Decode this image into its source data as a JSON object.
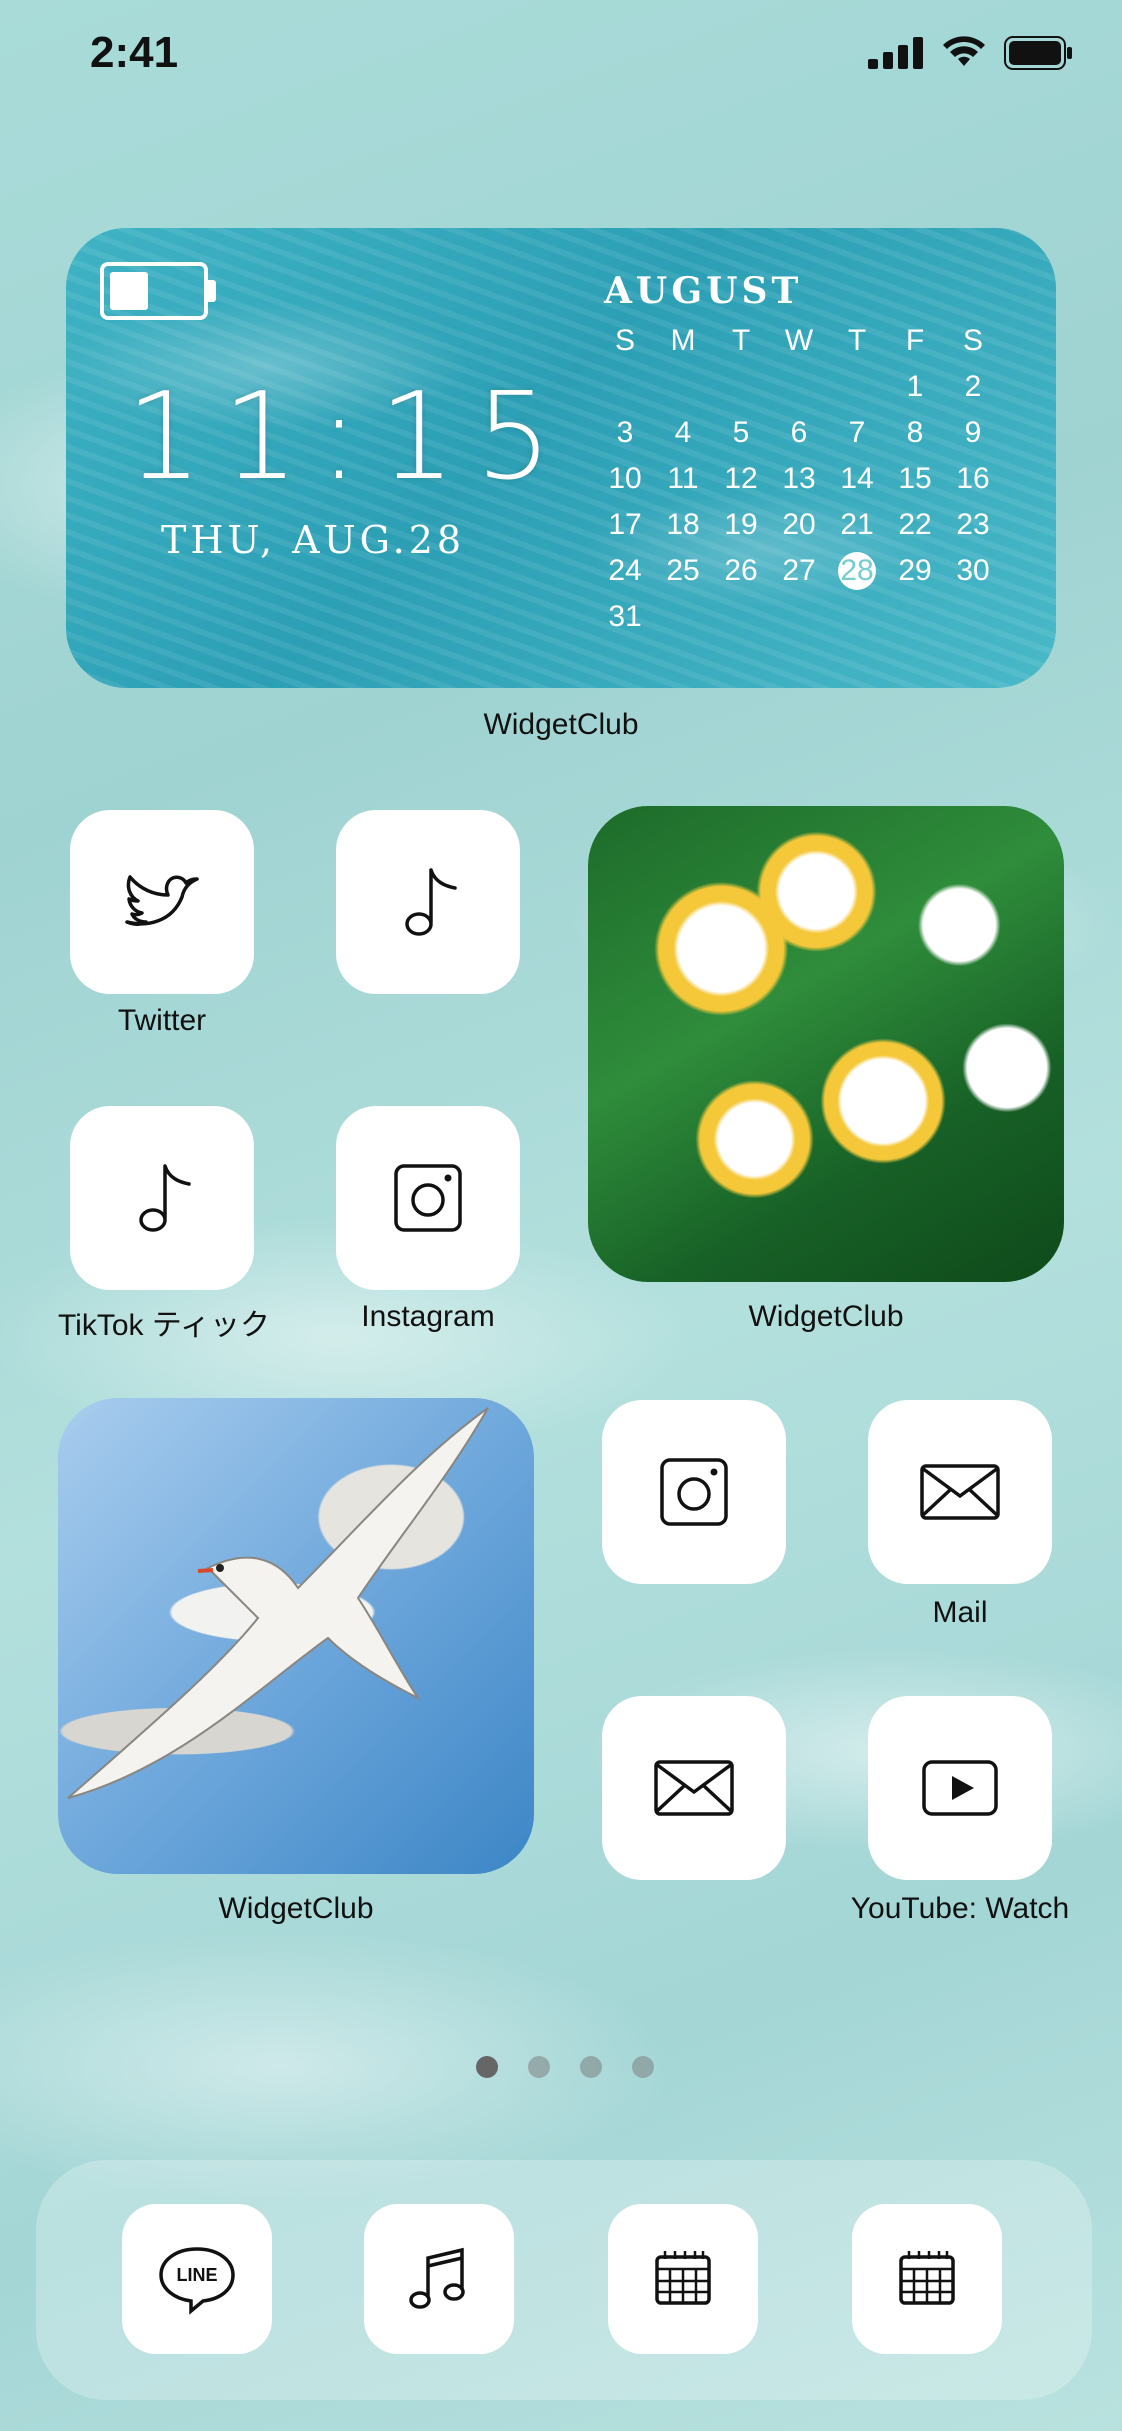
{
  "status": {
    "time": "2:41"
  },
  "widget_top": {
    "clock": "11:15",
    "date": "THU, AUG.28",
    "month": "AUGUST",
    "weekdays": [
      "S",
      "M",
      "T",
      "W",
      "T",
      "F",
      "S"
    ],
    "days": [
      "",
      "",
      "",
      "",
      "",
      "1",
      "2",
      "3",
      "4",
      "5",
      "6",
      "7",
      "8",
      "9",
      "10",
      "11",
      "12",
      "13",
      "14",
      "15",
      "16",
      "17",
      "18",
      "19",
      "20",
      "21",
      "22",
      "23",
      "24",
      "25",
      "26",
      "27",
      "28",
      "29",
      "30",
      "31"
    ],
    "today": "28",
    "label": "WidgetClub"
  },
  "apps": {
    "twitter": "Twitter",
    "tiktok": "TikTok ティック",
    "instagram": "Instagram",
    "flowers_widget": "WidgetClub",
    "bird_widget": "WidgetClub",
    "mail": "Mail",
    "youtube": "YouTube: Watch"
  },
  "pages": {
    "count": 4,
    "active": 1
  }
}
